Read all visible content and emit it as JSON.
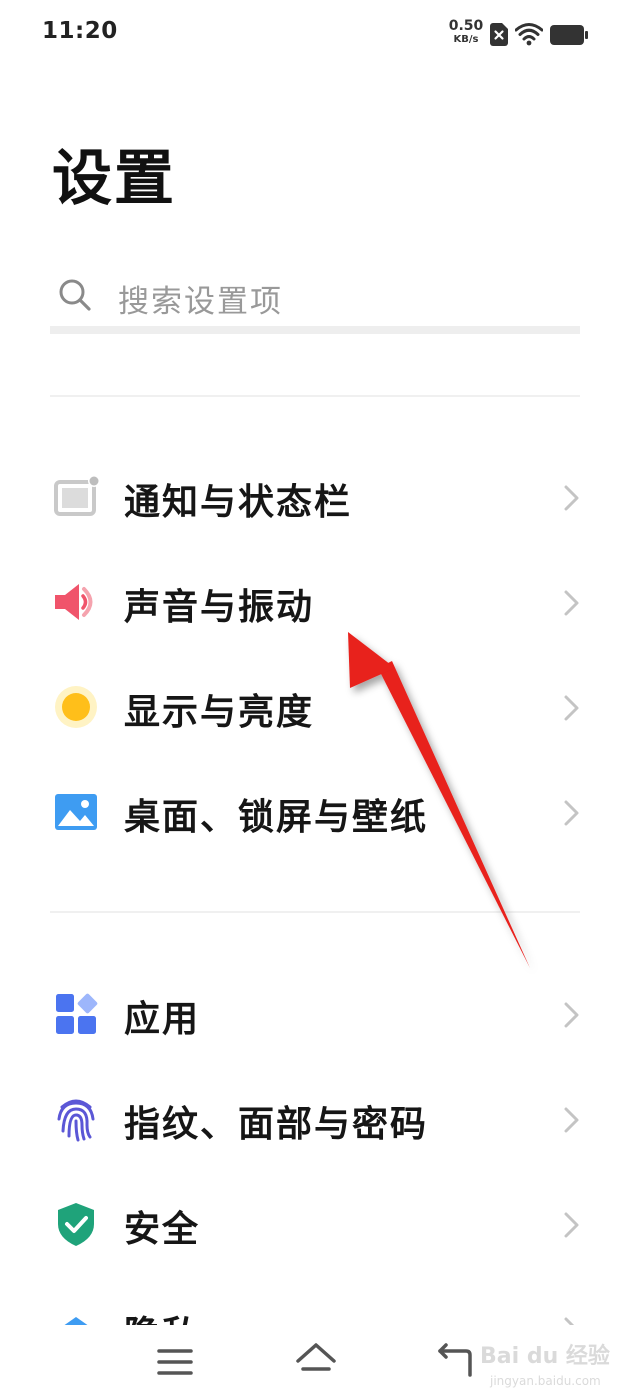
{
  "status_bar": {
    "time": "11:20",
    "net_speed_value": "0.50",
    "net_speed_unit": "KB/s",
    "icons": [
      "sim-off-icon",
      "wifi-icon",
      "battery-icon"
    ]
  },
  "page": {
    "title": "设置"
  },
  "search": {
    "placeholder": "搜索设置项",
    "icon": "search-icon"
  },
  "settings": {
    "items": [
      {
        "label": "通知与状态栏",
        "icon": "notification-status-bar-icon",
        "color": "#c7c7c7"
      },
      {
        "label": "声音与振动",
        "icon": "speaker-icon",
        "color": "#f0546b"
      },
      {
        "label": "显示与亮度",
        "icon": "brightness-sun-icon",
        "color": "#ffbf1a"
      },
      {
        "label": "桌面、锁屏与壁纸",
        "icon": "wallpaper-image-icon",
        "color": "#3e9cf2"
      },
      {
        "label": "应用",
        "icon": "apps-grid-icon",
        "color": "#4b74f0"
      },
      {
        "label": "指纹、面部与密码",
        "icon": "fingerprint-icon",
        "color": "#5b57d6"
      },
      {
        "label": "安全",
        "icon": "shield-check-icon",
        "color": "#1fa37a"
      },
      {
        "label": "隐私",
        "icon": "privacy-icon",
        "color": "#3e9cf2"
      }
    ]
  },
  "nav_bar": {
    "icons": [
      "menu-icon",
      "home-icon",
      "back-icon"
    ]
  },
  "watermark": {
    "text": "Bai du 经验",
    "sub": "jingyan.baidu.com"
  },
  "annotation": {
    "arrow_color": "#e8201f"
  }
}
